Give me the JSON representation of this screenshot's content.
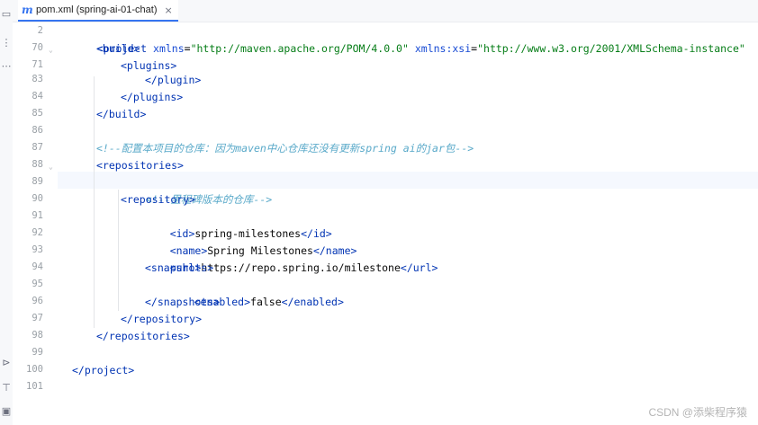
{
  "tab": {
    "title": "pom.xml (spring-ai-01-chat)",
    "close": "×"
  },
  "watermark": "CSDN @添柴程序猿",
  "lines": [
    {
      "n": "2",
      "code": "<project xmlns=\"http://maven.apache.org/POM/4.0.0\" xmlns:xsi=\"http://www.w3.org/2001/XMLSchema-instance\""
    },
    {
      "n": "70",
      "code": "<build>"
    },
    {
      "n": "71",
      "code": "<plugins>"
    },
    {
      "n": "83",
      "code": "</plugin>"
    },
    {
      "n": "84",
      "code": "</plugins>"
    },
    {
      "n": "85",
      "code": "</build>"
    },
    {
      "n": "86",
      "code": ""
    },
    {
      "n": "87",
      "code": "<!--配置本项目的仓库：因为maven中心仓库还没有更新spring ai的jar包-->"
    },
    {
      "n": "88",
      "code": "<repositories>"
    },
    {
      "n": "89",
      "code": "<!--里程碑版本的仓库-->"
    },
    {
      "n": "90",
      "code": "<repository>"
    },
    {
      "n": "91",
      "code": "<id>spring-milestones</id>"
    },
    {
      "n": "92",
      "code": "<name>Spring Milestones</name>"
    },
    {
      "n": "93",
      "code": "<url>https://repo.spring.io/milestone</url>"
    },
    {
      "n": "94",
      "code": "<snapshots>"
    },
    {
      "n": "95",
      "code": "<enabled>false</enabled>"
    },
    {
      "n": "96",
      "code": "</snapshots>"
    },
    {
      "n": "97",
      "code": "</repository>"
    },
    {
      "n": "98",
      "code": "</repositories>"
    },
    {
      "n": "99",
      "code": ""
    },
    {
      "n": "100",
      "code": "</project>"
    },
    {
      "n": "101",
      "code": ""
    }
  ]
}
